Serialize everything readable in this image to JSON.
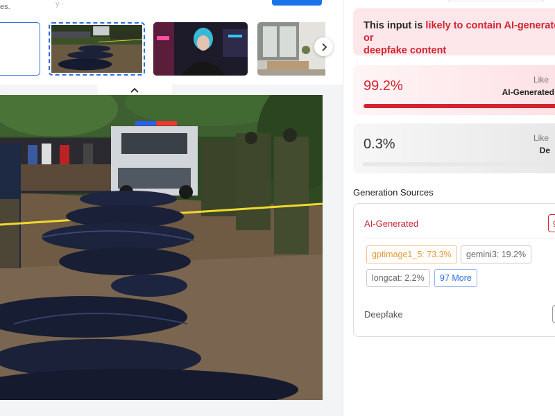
{
  "header": {
    "text_fragment": "es.",
    "faint_fragment": "y                                                                                    ·"
  },
  "thumbnails": [
    {
      "id": "upload",
      "selected": false
    },
    {
      "id": "sample-1",
      "selected": true
    },
    {
      "id": "sample-2",
      "selected": false
    },
    {
      "id": "sample-3",
      "selected": false
    }
  ],
  "icons": {
    "next": "chevron-right-icon",
    "collapse": "chevron-up-icon"
  },
  "colors": {
    "accent_blue": "#2d6fe0",
    "danger_red": "#d4232f",
    "verdict_bg": "#fde7ea"
  },
  "result": {
    "verdict_prefix": "This input is ",
    "verdict_highlight": "likely to contain AI-generated or",
    "verdict_suffix": "deepfake content",
    "ai": {
      "percent": "99.2%",
      "fraction": 0.992,
      "label_line1": "Like",
      "label_line2": "AI-Generated"
    },
    "deepfake": {
      "percent": "0.3%",
      "fraction": 0.003,
      "label_line1": "Like",
      "label_line2": "De"
    }
  },
  "sources": {
    "title": "Generation Sources",
    "ai_label": "AI-Generated",
    "ai_badge": "9",
    "chips": [
      {
        "text": "gptimage1_5: 73.3%",
        "style": "orange"
      },
      {
        "text": "gemini3: 19.2%",
        "style": "gray"
      },
      {
        "text": "longcat: 2.2%",
        "style": "gray"
      },
      {
        "text": "97 More",
        "style": "blue"
      }
    ],
    "deepfake_label": "Deepfake"
  }
}
